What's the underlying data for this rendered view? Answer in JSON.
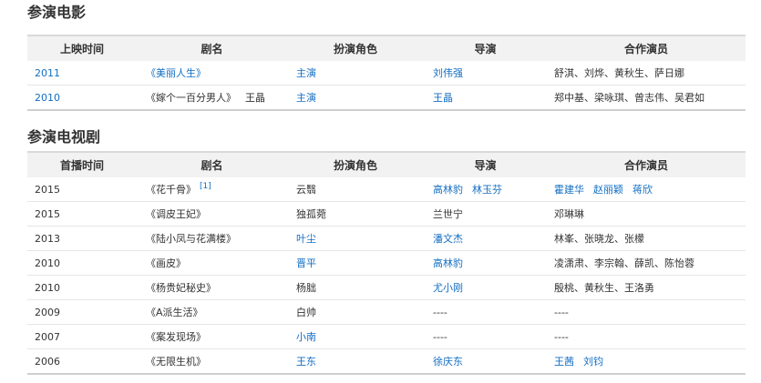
{
  "movies": {
    "title": "参演电影",
    "headers": [
      "上映时间",
      "剧名",
      "扮演角色",
      "导演",
      "合作演员"
    ],
    "rows": [
      {
        "year": "2011",
        "title": "《美丽人生》",
        "extra": "",
        "role": "主演",
        "director": "刘伟强",
        "costars": "舒淇、刘烨、黄秋生、萨日娜"
      },
      {
        "year": "2010",
        "title": "《嫁个一百分男人》",
        "extra": "王晶",
        "role": "主演",
        "director": "王晶",
        "costars": "郑中基、梁咏琪、曾志伟、吴君如"
      }
    ]
  },
  "tv": {
    "title": "参演电视剧",
    "headers": [
      "首播时间",
      "剧名",
      "扮演角色",
      "导演",
      "合作演员"
    ],
    "rows": [
      {
        "year": "2015",
        "title": "《花千骨》",
        "ref": "[1]",
        "role": "云翳",
        "director_a": "高林豹",
        "director_b": "林玉芬",
        "costar_a": "霍建华",
        "costar_b": "赵丽颖",
        "costar_c": "蒋欣"
      },
      {
        "year": "2015",
        "title": "《调皮王妃》",
        "role": "独孤菀",
        "director": "兰世宁",
        "costars": "邓琳琳"
      },
      {
        "year": "2013",
        "title": "《陆小凤与花满楼》",
        "role": "叶尘",
        "director": "潘文杰",
        "costars": "林峯、张晓龙、张檬"
      },
      {
        "year": "2010",
        "title": "《画皮》",
        "role": "晋平",
        "director": "高林豹",
        "costars": "凌潇肃、李宗翰、薛凯、陈怡蓉"
      },
      {
        "year": "2010",
        "title": "《杨贵妃秘史》",
        "role": "杨胐",
        "director": "尤小刚",
        "costars": "殷桃、黄秋生、王洛勇"
      },
      {
        "year": "2009",
        "title": "《A派生活》",
        "role": "白帅",
        "director": "----",
        "costars": "----"
      },
      {
        "year": "2007",
        "title": "《案发现场》",
        "role": "小南",
        "director": "----",
        "costars": "----"
      },
      {
        "year": "2006",
        "title": "《无限生机》",
        "role": "王东",
        "director": "徐庆东",
        "costar_a": "王茜",
        "costar_b": "刘钧"
      }
    ]
  }
}
